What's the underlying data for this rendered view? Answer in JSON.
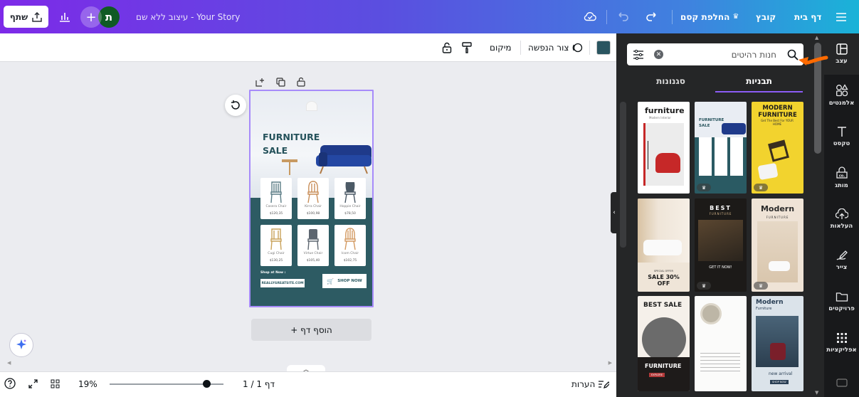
{
  "topbar": {
    "home": "דף בית",
    "file": "קובץ",
    "magic_switch": "החלפת קסם",
    "doc_title": "עיצוב ללא שם - Your Story",
    "avatar_letter": "ת",
    "share": "שתף",
    "plus": "+"
  },
  "toolbar": {
    "dropdown_shape": "צור הנפשה",
    "position": "מיקום",
    "color_value": "#2a5560"
  },
  "design": {
    "title": "FURNITURE SALE",
    "products": [
      {
        "name": "Casera Chair",
        "price": "$120,35"
      },
      {
        "name": "Kirra Chair",
        "price": "$100,98"
      },
      {
        "name": "Hoppie Chair",
        "price": "$78,50"
      },
      {
        "name": "Cugi Chair",
        "price": "$130,25"
      },
      {
        "name": "Virtue Chair",
        "price": "$105,40"
      },
      {
        "name": "Icom Chair",
        "price": "$102,75"
      }
    ],
    "shop_at": "Shop at Now :",
    "url": "REALLYGREATSITE.COM",
    "shop_now": "SHOP NOW"
  },
  "canvas": {
    "add_page": "+ הוסף דף"
  },
  "bottombar": {
    "notes": "הערות",
    "page_indicator": "דף 1 / 1",
    "zoom": "19%",
    "zoom_fraction": 0.85
  },
  "panel": {
    "search_placeholder": "חנות רהיטים",
    "tab_templates": "תבניות",
    "tab_styles": "סגנונות",
    "templates": [
      {
        "title": "furniture",
        "subtitle": "Modern Interior"
      },
      {
        "title": "FURNITURE SALE",
        "subtitle": ""
      },
      {
        "title": "MODERN FURNITURE",
        "subtitle": "Get The Best For YOUR HOME"
      },
      {
        "title": "SALE 30% OFF",
        "subtitle": "SPECIAL OFFER"
      },
      {
        "title": "BEST",
        "subtitle": "FURNITURE"
      },
      {
        "title": "Modern",
        "subtitle": "FURNITURE"
      },
      {
        "title": "BEST SALE",
        "subtitle": "FURNITURE"
      },
      {
        "title": "",
        "subtitle": ""
      },
      {
        "title": "Modern",
        "subtitle": "Furniture"
      }
    ],
    "tpl_texts": {
      "get_it_now": "GET IT NOW!",
      "new_arrival": "new arrival",
      "shop_now": "SHOP NOW",
      "explore": "EXPLORE"
    }
  },
  "rail": {
    "items": [
      {
        "label": "עצב",
        "icon": "layout-icon"
      },
      {
        "label": "אלמנטים",
        "icon": "elements-icon"
      },
      {
        "label": "טקסט",
        "icon": "text-icon"
      },
      {
        "label": "מותג",
        "icon": "brand-icon"
      },
      {
        "label": "העלאות",
        "icon": "upload-icon"
      },
      {
        "label": "צייר",
        "icon": "draw-icon"
      },
      {
        "label": "פרויקטים",
        "icon": "folder-icon"
      },
      {
        "label": "אפליקציות",
        "icon": "apps-icon"
      }
    ]
  }
}
